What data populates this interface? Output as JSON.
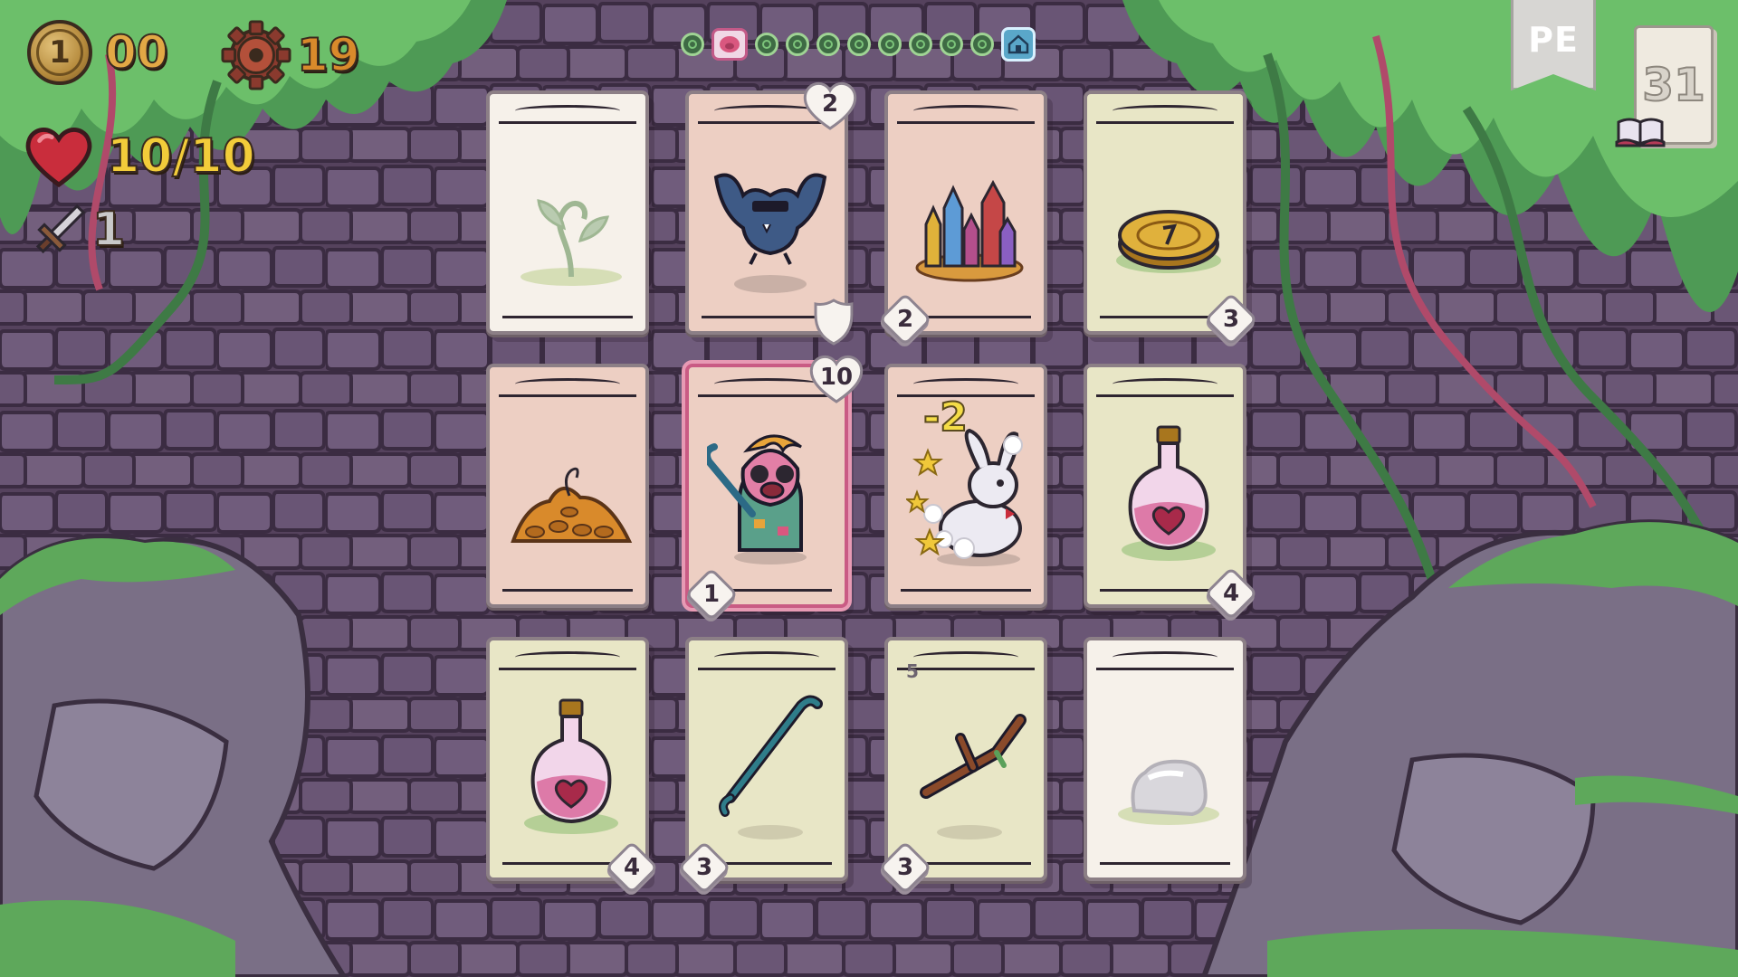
{
  "hud": {
    "coins": "00",
    "gears": "19",
    "health": "10/10",
    "attack": "1"
  },
  "progress": {
    "steps": [
      "step",
      "current-pig",
      "step",
      "step",
      "step",
      "step",
      "step",
      "step",
      "step",
      "step",
      "home"
    ]
  },
  "top_right": {
    "banner": "PE",
    "deck_count": "31"
  },
  "colors": {
    "coin_gold": "#e2a845",
    "gear_orange": "#d98a2b",
    "health_yellow": "#f2cc3a",
    "attack_gray": "#c9c9c9",
    "damage_yellow": "#f4dc47"
  },
  "cards": [
    {
      "id": "sprout",
      "color": "white",
      "icon": "sprout-icon"
    },
    {
      "id": "bat",
      "color": "pink",
      "icon": "bat-icon",
      "health": "2",
      "corner_value": "2"
    },
    {
      "id": "crystals",
      "color": "pink",
      "icon": "crystals-icon"
    },
    {
      "id": "gold-coin",
      "color": "green",
      "icon": "gold-coin-icon",
      "value": "3"
    },
    {
      "id": "dirt-pile",
      "color": "pink",
      "icon": "dirt-pile-icon"
    },
    {
      "id": "pig-hero",
      "color": "pink",
      "icon": "pig-hero-icon",
      "health": "10",
      "value": "1",
      "selected": true
    },
    {
      "id": "rabbit",
      "color": "pink",
      "icon": "rabbit-icon",
      "damage": "-2"
    },
    {
      "id": "potion-a",
      "color": "green",
      "icon": "health-potion-icon",
      "value": "4"
    },
    {
      "id": "potion-b",
      "color": "green",
      "icon": "health-potion-icon",
      "value": "4"
    },
    {
      "id": "crowbar",
      "color": "green",
      "icon": "crowbar-icon",
      "value": "3"
    },
    {
      "id": "stick",
      "color": "green",
      "icon": "stick-icon",
      "value": "3",
      "corner": "5"
    },
    {
      "id": "rock",
      "color": "white",
      "icon": "rock-icon"
    }
  ]
}
